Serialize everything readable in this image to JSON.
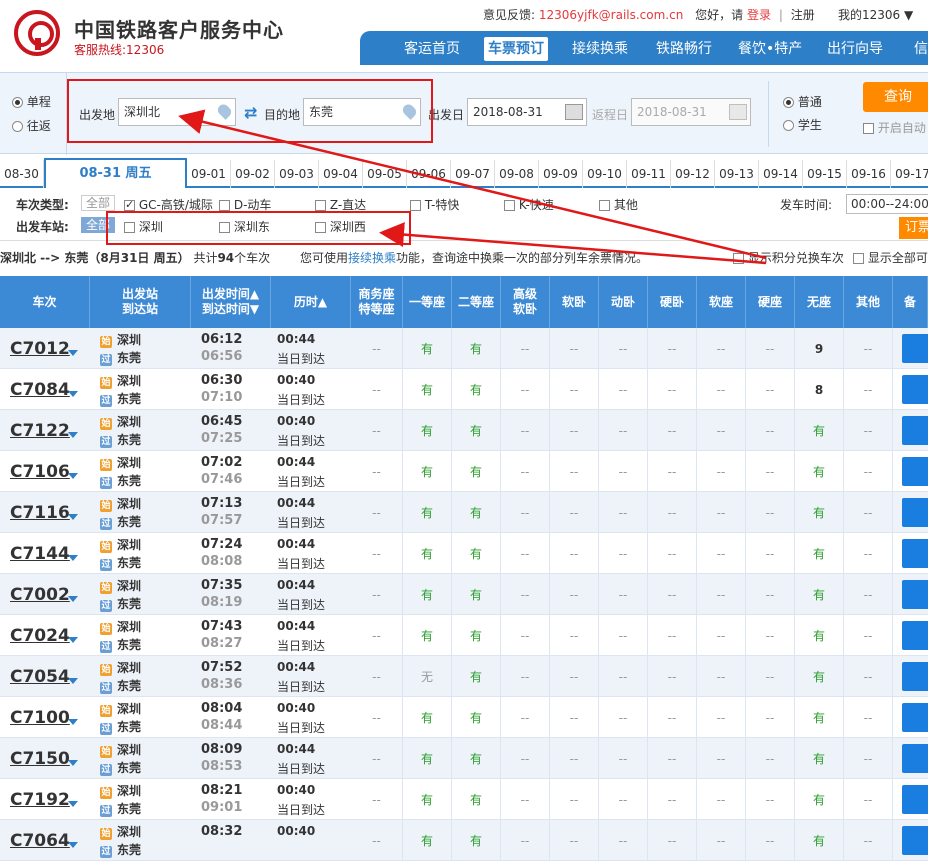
{
  "header": {
    "site_title": "中国铁路客户服务中心",
    "hotline": "客服热线:12306",
    "feedback_label": "意见反馈:",
    "feedback_email": "12306yjfk@rails.com.cn",
    "greeting": "您好，请",
    "login": "登录",
    "register": "注册",
    "my_account": "我的12306 ▼"
  },
  "nav": [
    {
      "label": "客运首页"
    },
    {
      "label": "车票预订"
    },
    {
      "label": "接续换乘"
    },
    {
      "label": "铁路畅行"
    },
    {
      "label": "餐饮•特产"
    },
    {
      "label": "出行向导"
    },
    {
      "label": "信"
    }
  ],
  "query": {
    "trip_single": "单程",
    "trip_round": "往返",
    "from_label": "出发地",
    "from_value": "深圳北",
    "to_label": "目的地",
    "to_value": "东莞",
    "depart_label": "出发日",
    "depart_value": "2018-08-31",
    "return_label": "返程日",
    "return_value": "2018-08-31",
    "type_normal": "普通",
    "type_student": "学生",
    "search": "查询",
    "auto_label": "开启自动"
  },
  "dates": [
    "08-30",
    "08-31 周五",
    "09-01",
    "09-02",
    "09-03",
    "09-04",
    "09-05",
    "09-06",
    "09-07",
    "09-08",
    "09-09",
    "09-10",
    "09-11",
    "09-12",
    "09-13",
    "09-14",
    "09-15",
    "09-16",
    "09-17"
  ],
  "filters": {
    "type_label": "车次类型:",
    "all": "全部",
    "types": [
      "GC-高铁/城际",
      "D-动车",
      "Z-直达",
      "T-特快",
      "K-快速",
      "其他"
    ],
    "station_label": "出发车站:",
    "stations": [
      "深圳",
      "深圳东",
      "深圳西"
    ],
    "time_label": "发车时间:",
    "time_value": "00:00--24:00",
    "book": "订票"
  },
  "summary": {
    "route": "深圳北 --> 东莞（8月31日  周五）",
    "count_prefix": "共计",
    "count": "94",
    "count_suffix": "个车次",
    "hint_a": "您可使用",
    "hint_link": "接续换乘",
    "hint_b": "功能，查询途中换乘一次的部分列车余票情况。",
    "show_points": "显示积分兑换车次",
    "show_all": "显示全部可"
  },
  "table_headers": [
    "车次",
    "出发站\n到达站",
    "出发时间▲\n到达时间▼",
    "历时▲",
    "商务座\n特等座",
    "一等座",
    "二等座",
    "高级\n软卧",
    "软卧",
    "动卧",
    "硬卧",
    "软座",
    "硬座",
    "无座",
    "其他",
    "备"
  ],
  "trains": [
    {
      "no": "C7012",
      "from": "深圳",
      "to": "东莞",
      "dep": "06:12",
      "arr": "06:56",
      "dur": "00:44",
      "day": "当日到达",
      "first": "有",
      "second": "有",
      "noseat": "9"
    },
    {
      "no": "C7084",
      "from": "深圳",
      "to": "东莞",
      "dep": "06:30",
      "arr": "07:10",
      "dur": "00:40",
      "day": "当日到达",
      "first": "有",
      "second": "有",
      "noseat": "8"
    },
    {
      "no": "C7122",
      "from": "深圳",
      "to": "东莞",
      "dep": "06:45",
      "arr": "07:25",
      "dur": "00:40",
      "day": "当日到达",
      "first": "有",
      "second": "有",
      "noseat": "有"
    },
    {
      "no": "C7106",
      "from": "深圳",
      "to": "东莞",
      "dep": "07:02",
      "arr": "07:46",
      "dur": "00:44",
      "day": "当日到达",
      "first": "有",
      "second": "有",
      "noseat": "有"
    },
    {
      "no": "C7116",
      "from": "深圳",
      "to": "东莞",
      "dep": "07:13",
      "arr": "07:57",
      "dur": "00:44",
      "day": "当日到达",
      "first": "有",
      "second": "有",
      "noseat": "有"
    },
    {
      "no": "C7144",
      "from": "深圳",
      "to": "东莞",
      "dep": "07:24",
      "arr": "08:08",
      "dur": "00:44",
      "day": "当日到达",
      "first": "有",
      "second": "有",
      "noseat": "有"
    },
    {
      "no": "C7002",
      "from": "深圳",
      "to": "东莞",
      "dep": "07:35",
      "arr": "08:19",
      "dur": "00:44",
      "day": "当日到达",
      "first": "有",
      "second": "有",
      "noseat": "有"
    },
    {
      "no": "C7024",
      "from": "深圳",
      "to": "东莞",
      "dep": "07:43",
      "arr": "08:27",
      "dur": "00:44",
      "day": "当日到达",
      "first": "有",
      "second": "有",
      "noseat": "有"
    },
    {
      "no": "C7054",
      "from": "深圳",
      "to": "东莞",
      "dep": "07:52",
      "arr": "08:36",
      "dur": "00:44",
      "day": "当日到达",
      "first": "无",
      "second": "有",
      "noseat": "有"
    },
    {
      "no": "C7100",
      "from": "深圳",
      "to": "东莞",
      "dep": "08:04",
      "arr": "08:44",
      "dur": "00:40",
      "day": "当日到达",
      "first": "有",
      "second": "有",
      "noseat": "有"
    },
    {
      "no": "C7150",
      "from": "深圳",
      "to": "东莞",
      "dep": "08:09",
      "arr": "08:53",
      "dur": "00:44",
      "day": "当日到达",
      "first": "有",
      "second": "有",
      "noseat": "有"
    },
    {
      "no": "C7192",
      "from": "深圳",
      "to": "东莞",
      "dep": "08:21",
      "arr": "09:01",
      "dur": "00:40",
      "day": "当日到达",
      "first": "有",
      "second": "有",
      "noseat": "有"
    },
    {
      "no": "C7064",
      "from": "深圳",
      "to": "东莞",
      "dep": "08:32",
      "arr": "",
      "dur": "00:40",
      "day": "",
      "first": "有",
      "second": "有",
      "noseat": "有"
    }
  ],
  "dash": "--",
  "station_icons": {
    "start": "始",
    "pass": "过"
  },
  "colors": {
    "nav_blue": "#2d7fc7",
    "orange": "#ff8a00",
    "annotation_red": "#e01818",
    "available_green": "#2a9d2a"
  }
}
